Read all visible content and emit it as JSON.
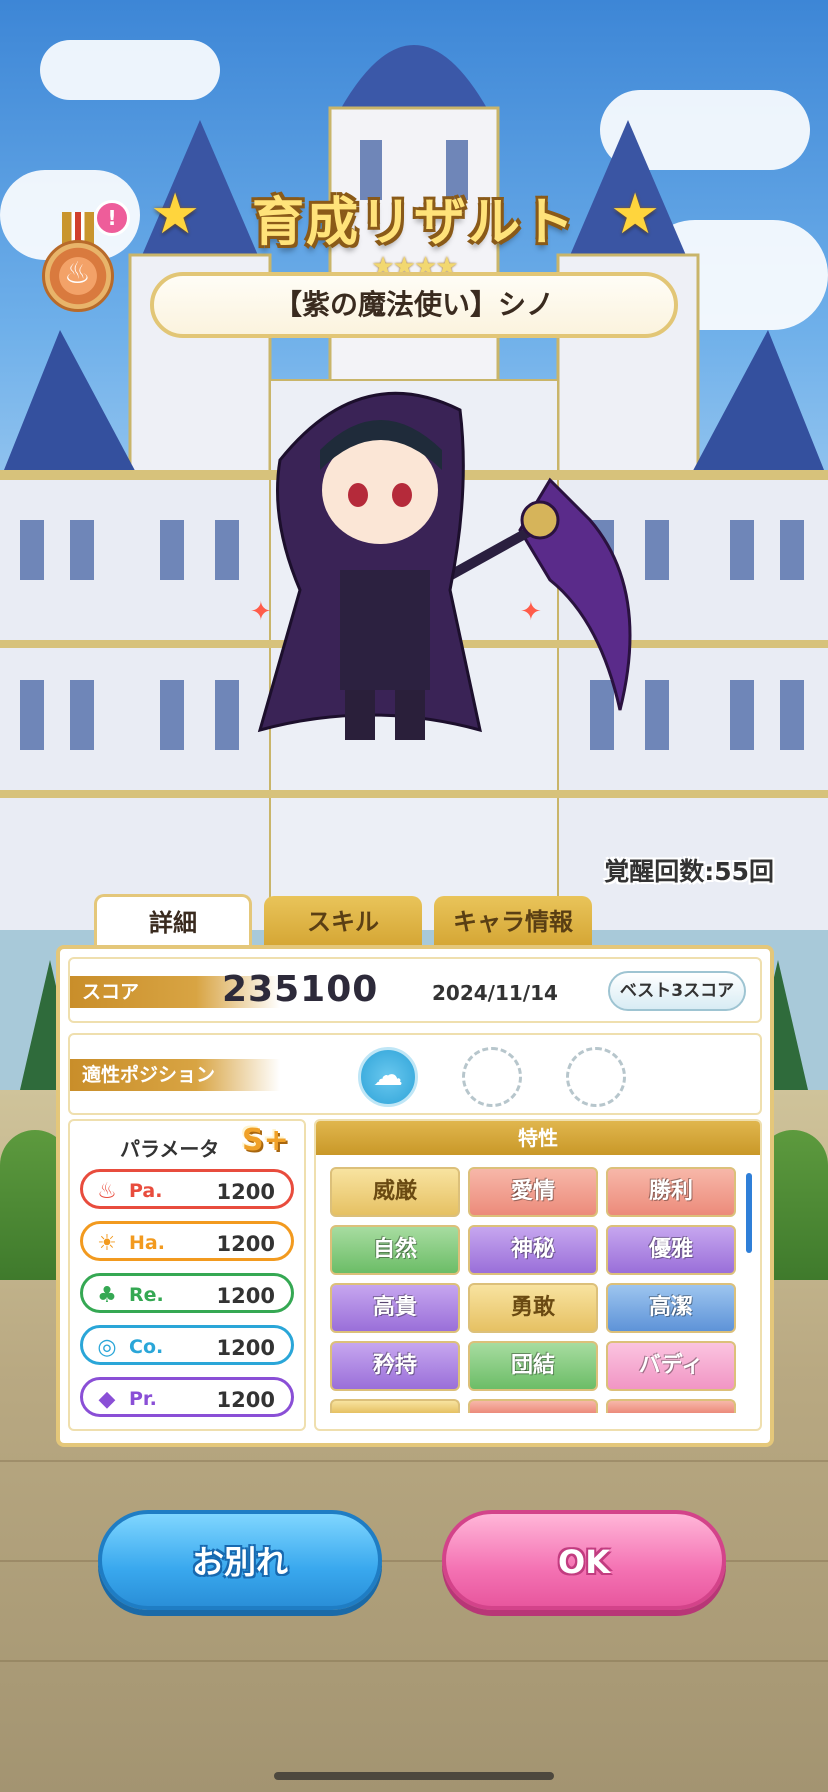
{
  "header": {
    "title": "育成リザルト",
    "rarity_stars": "★★★★",
    "character_name": "【紫の魔法使い】シノ",
    "notify_badge": "!"
  },
  "awaken_count": "覚醒回数:55回",
  "tabs": [
    {
      "label": "詳細",
      "active": true
    },
    {
      "label": "スキル",
      "active": false
    },
    {
      "label": "キャラ情報",
      "active": false
    }
  ],
  "score": {
    "tag": "スコア",
    "value": "235100",
    "date": "2024/11/14",
    "best_button": "ベスト3スコア"
  },
  "position": {
    "tag": "適性ポジション"
  },
  "params": {
    "title": "パラメータ",
    "rank": "S+",
    "items": [
      {
        "label": "Pa.",
        "value": "1200",
        "color": "#e84c3d"
      },
      {
        "label": "Ha.",
        "value": "1200",
        "color": "#f29a1f"
      },
      {
        "label": "Re.",
        "value": "1200",
        "color": "#35a853"
      },
      {
        "label": "Co.",
        "value": "1200",
        "color": "#2aa6d8"
      },
      {
        "label": "Pr.",
        "value": "1200",
        "color": "#8a4fd6"
      }
    ]
  },
  "traits": {
    "header": "特性",
    "items": [
      {
        "label": "威厳",
        "style": "gold"
      },
      {
        "label": "愛情",
        "style": "red"
      },
      {
        "label": "勝利",
        "style": "red"
      },
      {
        "label": "自然",
        "style": "green"
      },
      {
        "label": "神秘",
        "style": "purple"
      },
      {
        "label": "優雅",
        "style": "purple"
      },
      {
        "label": "高貴",
        "style": "purple"
      },
      {
        "label": "勇敢",
        "style": "gold"
      },
      {
        "label": "高潔",
        "style": "blue"
      },
      {
        "label": "矜持",
        "style": "purple"
      },
      {
        "label": "団結",
        "style": "green"
      },
      {
        "label": "バディ",
        "style": "pink"
      }
    ]
  },
  "buttons": {
    "farewell": "お別れ",
    "ok": "OK"
  }
}
